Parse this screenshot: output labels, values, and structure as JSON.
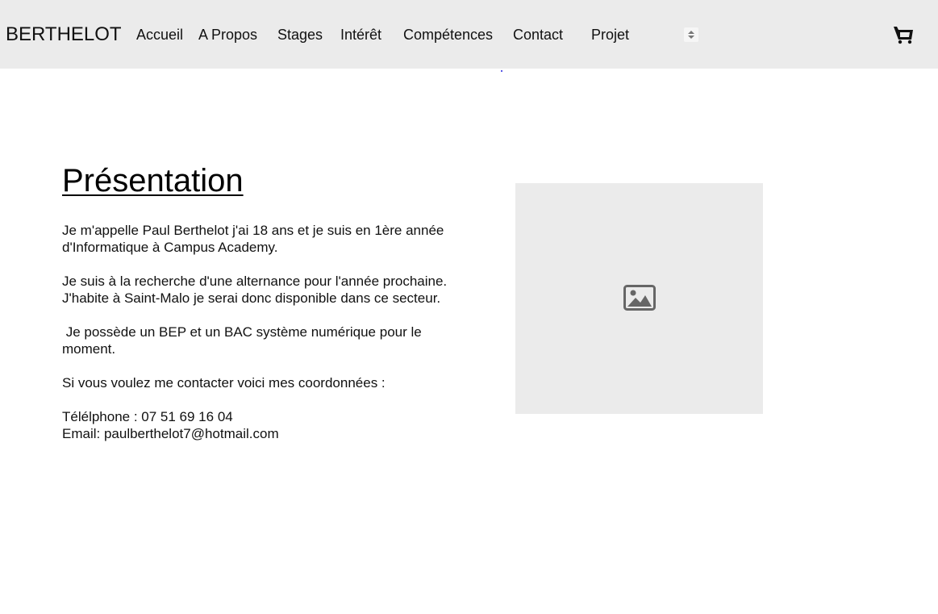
{
  "header": {
    "brand": "BERTHELOT",
    "nav": [
      {
        "label": "Accueil"
      },
      {
        "label": "A Propos"
      },
      {
        "label": "Stages"
      },
      {
        "label": "Intérêt"
      },
      {
        "label": "Compétences"
      },
      {
        "label": "Contact"
      },
      {
        "label": "Projet"
      }
    ],
    "more_icon": "sort-arrows-icon",
    "cart_icon": "shopping-cart-icon"
  },
  "main": {
    "title": "Présentation",
    "bio": {
      "p1_line1": "Je m'appelle Paul Berthelot j'ai 18 ans et je suis en 1ère année",
      "p1_line2": "d'Informatique à Campus Academy.",
      "p2_line1": "Je suis à la recherche d'une alternance pour l'année prochaine.",
      "p2_line2": "J'habite à Saint-Malo je serai donc disponible dans ce secteur.",
      "p3_line1": " Je possède un BEP et un BAC système numérique pour le",
      "p3_line2": "moment.",
      "p4": "Si vous voulez me contacter voici mes coordonnées :",
      "phone": "Télélphone : 07 51 69 16 04",
      "email": "Email: paulberthelot7@hotmail.com"
    },
    "image_icon": "image-placeholder-icon"
  },
  "colors": {
    "header_bg": "#ebebeb",
    "placeholder_bg": "#ebebeb",
    "icon_gray": "#666666",
    "text": "#111111"
  }
}
